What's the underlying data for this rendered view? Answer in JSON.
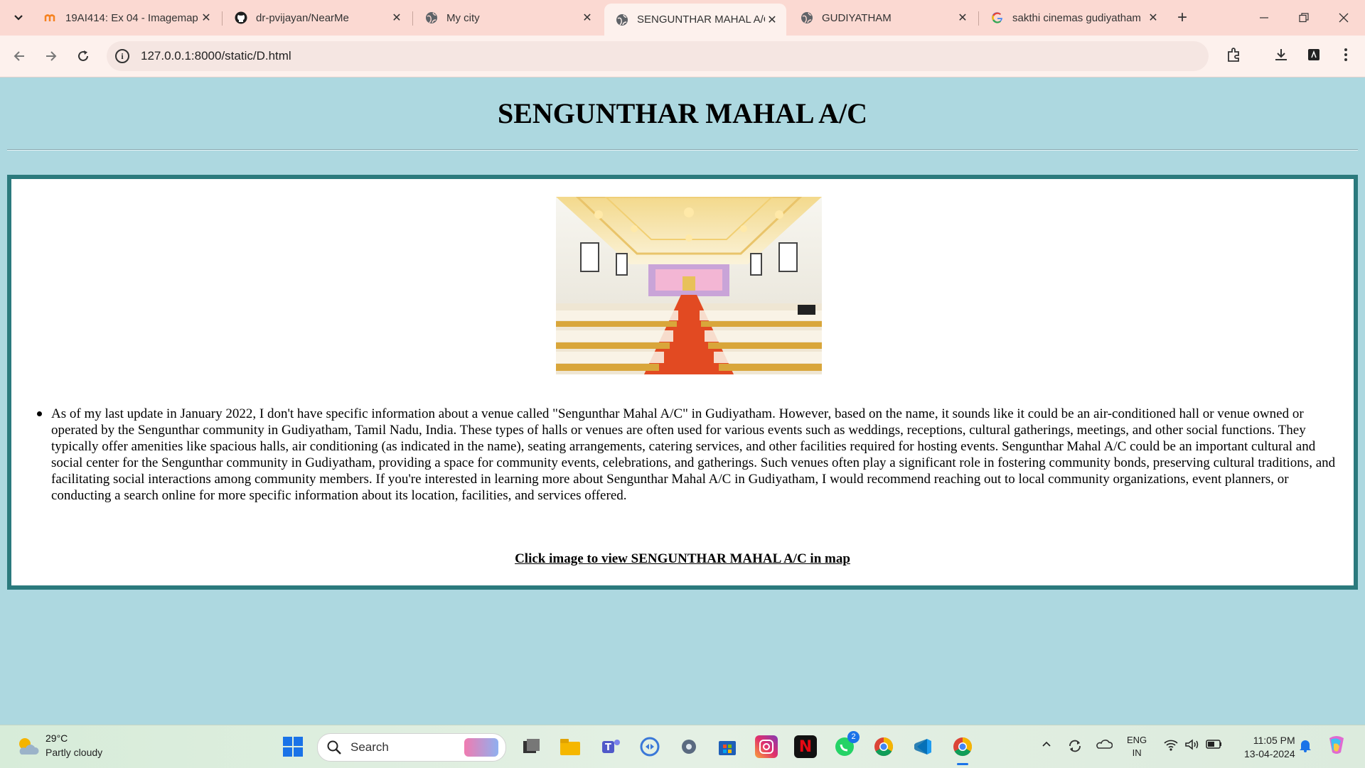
{
  "browser": {
    "tabs": [
      {
        "title": "19AI414: Ex 04 - Imagemap",
        "icon": "moodle-icon"
      },
      {
        "title": "dr-pvijayan/NearMe",
        "icon": "github-icon"
      },
      {
        "title": "My city",
        "icon": "globe-icon"
      },
      {
        "title": "SENGUNTHAR MAHAL A/C",
        "icon": "globe-icon",
        "active": true
      },
      {
        "title": "GUDIYATHAM",
        "icon": "globe-icon"
      },
      {
        "title": "sakthi cinemas gudiyatham",
        "icon": "google-icon"
      }
    ],
    "url": "127.0.0.1:8000/static/D.html"
  },
  "page": {
    "heading": "SENGUNTHAR MAHAL A/C",
    "image_alt": "SENGUNTHAR MAHAL A/C",
    "description": "As of my last update in January 2022, I don't have specific information about a venue called \"Sengunthar Mahal A/C\" in Gudiyatham. However, based on the name, it sounds like it could be an air-conditioned hall or venue owned or operated by the Sengunthar community in Gudiyatham, Tamil Nadu, India. These types of halls or venues are often used for various events such as weddings, receptions, cultural gatherings, meetings, and other social functions. They typically offer amenities like spacious halls, air conditioning (as indicated in the name), seating arrangements, catering services, and other facilities required for hosting events. Sengunthar Mahal A/C could be an important cultural and social center for the Sengunthar community in Gudiyatham, providing a space for community events, celebrations, and gatherings. Such venues often play a significant role in fostering community bonds, preserving cultural traditions, and facilitating social interactions among community members. If you're interested in learning more about Sengunthar Mahal A/C in Gudiyatham, I would recommend reaching out to local community organizations, event planners, or conducting a search online for more specific information about its location, facilities, and services offered.",
    "map_link": "Click image to view SENGUNTHAR MAHAL A/C in map",
    "colors": {
      "background": "#add8e0",
      "border": "#2b7a7d"
    }
  },
  "taskbar": {
    "weather_temp": "29°C",
    "weather_desc": "Partly cloudy",
    "search_label": "Search",
    "whatsapp_badge": "2",
    "lang_top": "ENG",
    "lang_bottom": "IN",
    "time": "11:05 PM",
    "date": "13-04-2024"
  }
}
